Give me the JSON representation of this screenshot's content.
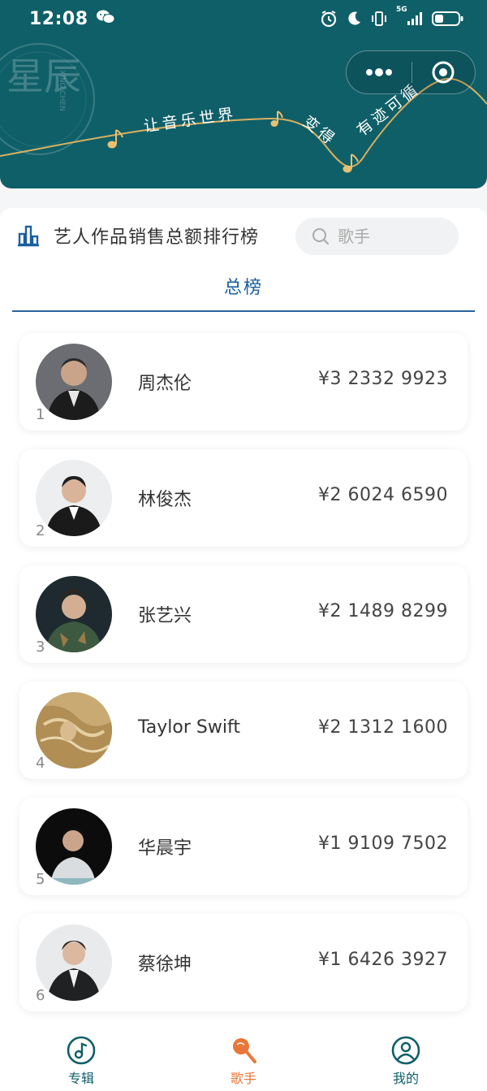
{
  "status_bar": {
    "time": "12:08",
    "network": "5G"
  },
  "banner": {
    "logo_text": "星辰",
    "logo_sub": "XING CHEN",
    "slogan_parts": [
      "让音乐世界",
      "变得",
      "有迹可循"
    ],
    "colors": {
      "background": "#0f5f68",
      "line": "#d9b060"
    }
  },
  "page": {
    "title": "艺人作品销售总额排行榜",
    "search_placeholder": "歌手",
    "tab": "总榜"
  },
  "ranking": [
    {
      "rank": "1",
      "name": "周杰伦",
      "amount": "¥3 2332 9923"
    },
    {
      "rank": "2",
      "name": "林俊杰",
      "amount": "¥2 6024 6590"
    },
    {
      "rank": "3",
      "name": "张艺兴",
      "amount": "¥2 1489 8299"
    },
    {
      "rank": "4",
      "name": "Taylor Swift",
      "amount": "¥2 1312 1600"
    },
    {
      "rank": "5",
      "name": "华晨宇",
      "amount": "¥1 9109 7502"
    },
    {
      "rank": "6",
      "name": "蔡徐坤",
      "amount": "¥1 6426 3927"
    }
  ],
  "tabbar": {
    "items": [
      {
        "label": "专辑",
        "icon": "music-note-icon",
        "active": false
      },
      {
        "label": "歌手",
        "icon": "microphone-icon",
        "active": true
      },
      {
        "label": "我的",
        "icon": "user-icon",
        "active": false
      }
    ],
    "colors": {
      "active": "#e8773a",
      "inactive": "#0f5f68"
    }
  }
}
